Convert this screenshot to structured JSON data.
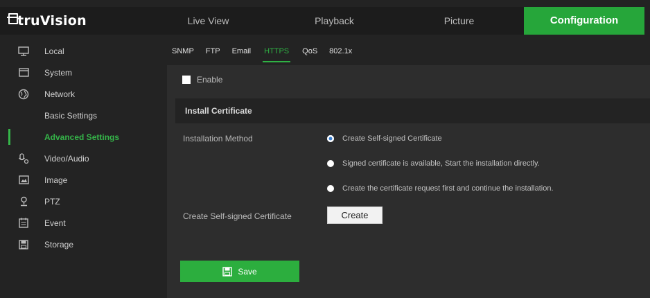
{
  "app": {
    "logo_text": "truVision"
  },
  "nav": {
    "live_view": "Live View",
    "playback": "Playback",
    "picture": "Picture",
    "configuration": "Configuration"
  },
  "sidebar": {
    "local": "Local",
    "system": "System",
    "network": "Network",
    "basic_settings": "Basic Settings",
    "advanced_settings": "Advanced Settings",
    "video_audio": "Video/Audio",
    "image": "Image",
    "ptz": "PTZ",
    "event": "Event",
    "storage": "Storage"
  },
  "subtabs": {
    "snmp": "SNMP",
    "ftp": "FTP",
    "email": "Email",
    "https": "HTTPS",
    "qos": "QoS",
    "dot1x": "802.1x"
  },
  "form": {
    "enable_label": "Enable",
    "enable_checked": false,
    "section_title": "Install Certificate",
    "installation_method_label": "Installation Method",
    "option_self_signed": "Create Self-signed Certificate",
    "option_signed_available": "Signed certificate is available, Start the installation directly.",
    "option_request_first": "Create the certificate request first and continue the installation.",
    "selected_option": "option_self_signed",
    "create_self_signed_label": "Create Self-signed Certificate",
    "create_button": "Create",
    "save_button": "Save"
  },
  "colors": {
    "accent_green": "#26a63a",
    "background": "#232323",
    "panel": "#2d2d2d"
  }
}
